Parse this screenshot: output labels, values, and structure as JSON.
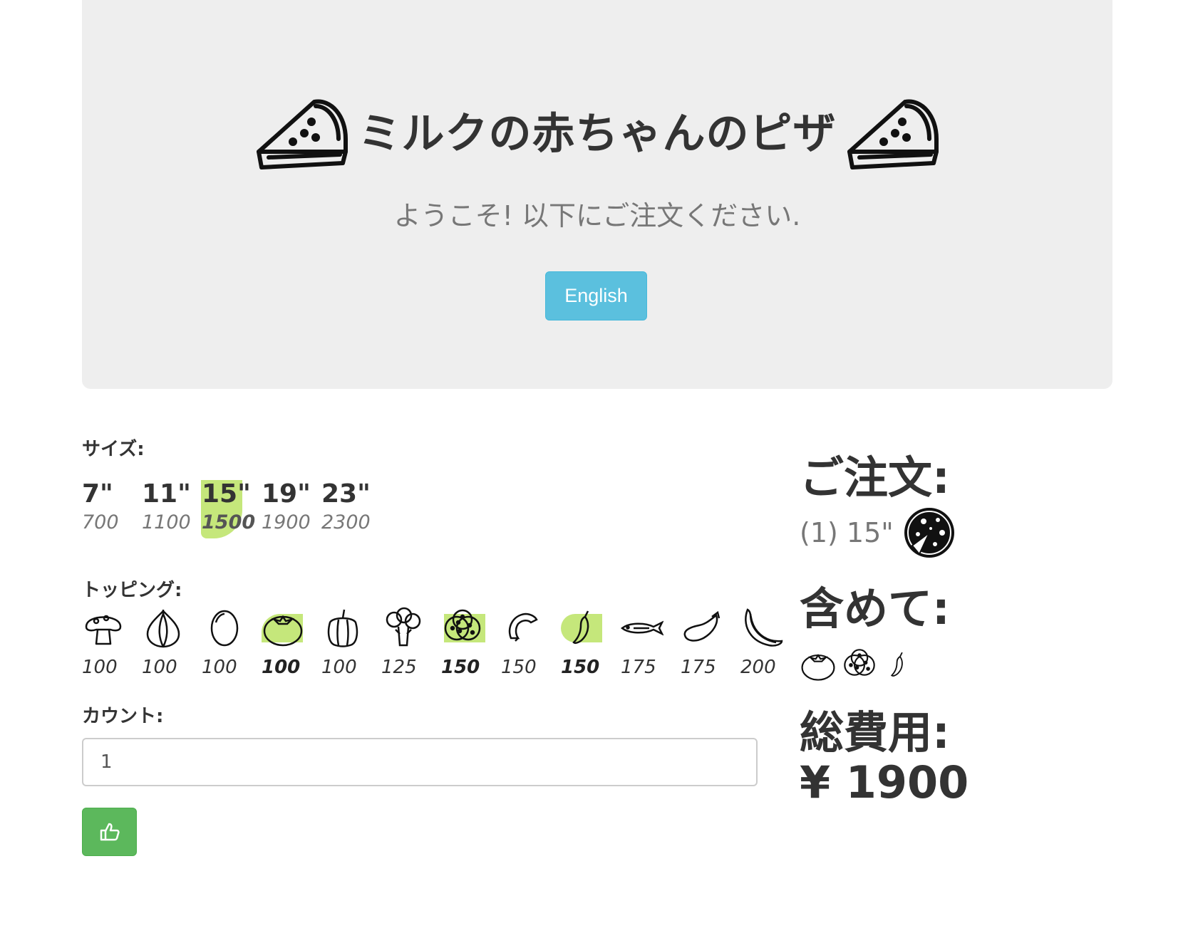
{
  "header": {
    "title": "ミルクの赤ちゃんのピザ",
    "subtitle": "ようこそ! 以下にご注文ください.",
    "language_button": "English",
    "icon": "pizza-slice-icon"
  },
  "form": {
    "size_label": "サイズ:",
    "sizes": [
      {
        "label": "7\"",
        "price": "700",
        "selected": false
      },
      {
        "label": "11\"",
        "price": "1100",
        "selected": false
      },
      {
        "label": "15\"",
        "price": "1500",
        "selected": true
      },
      {
        "label": "19\"",
        "price": "1900",
        "selected": false
      },
      {
        "label": "23\"",
        "price": "2300",
        "selected": false
      }
    ],
    "toppings_label": "トッピング:",
    "toppings": [
      {
        "icon": "mushroom-icon",
        "price": "100",
        "selected": false
      },
      {
        "icon": "onion-icon",
        "price": "100",
        "selected": false
      },
      {
        "icon": "olive-icon",
        "price": "100",
        "selected": false
      },
      {
        "icon": "tomato-icon",
        "price": "100",
        "selected": true
      },
      {
        "icon": "bell-pepper-icon",
        "price": "100",
        "selected": false
      },
      {
        "icon": "broccoli-icon",
        "price": "125",
        "selected": false
      },
      {
        "icon": "pepperoni-icon",
        "price": "150",
        "selected": true
      },
      {
        "icon": "sausage-icon",
        "price": "150",
        "selected": false
      },
      {
        "icon": "chili-pepper-icon",
        "price": "150",
        "selected": true
      },
      {
        "icon": "anchovy-icon",
        "price": "175",
        "selected": false
      },
      {
        "icon": "eggplant-icon",
        "price": "175",
        "selected": false
      },
      {
        "icon": "banana-icon",
        "price": "200",
        "selected": false
      }
    ],
    "count_label": "カウント:",
    "count_value": "1",
    "submit_icon": "thumbs-up-icon"
  },
  "summary": {
    "order_heading": "ご注文:",
    "order_line": "(1) 15\"",
    "order_icon": "pizza-icon",
    "included_heading": "含めて:",
    "included_icons": [
      "tomato-icon",
      "pepperoni-icon",
      "chili-pepper-icon"
    ],
    "total_heading": "総費用:",
    "total_value": "¥ 1900"
  },
  "colors": {
    "hero_bg": "#eeeeee",
    "selected_highlight": "#c5e77b",
    "info_button": "#5bc0de",
    "success_button": "#5cb85c"
  }
}
